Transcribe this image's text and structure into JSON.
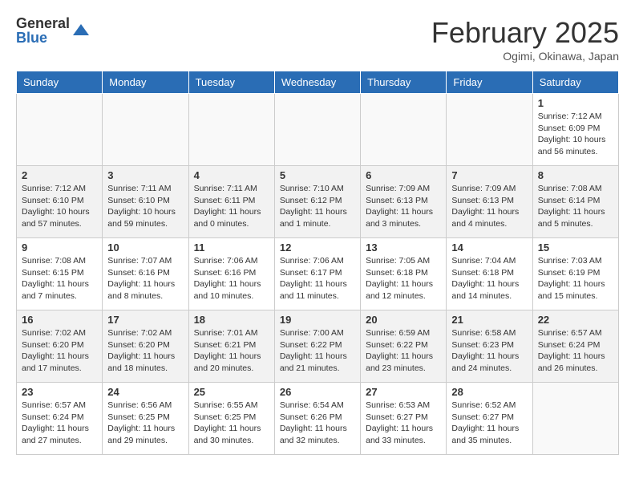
{
  "logo": {
    "general": "General",
    "blue": "Blue"
  },
  "header": {
    "month": "February 2025",
    "location": "Ogimi, Okinawa, Japan"
  },
  "weekdays": [
    "Sunday",
    "Monday",
    "Tuesday",
    "Wednesday",
    "Thursday",
    "Friday",
    "Saturday"
  ],
  "weeks": [
    [
      {
        "day": "",
        "info": ""
      },
      {
        "day": "",
        "info": ""
      },
      {
        "day": "",
        "info": ""
      },
      {
        "day": "",
        "info": ""
      },
      {
        "day": "",
        "info": ""
      },
      {
        "day": "",
        "info": ""
      },
      {
        "day": "1",
        "info": "Sunrise: 7:12 AM\nSunset: 6:09 PM\nDaylight: 10 hours\nand 56 minutes."
      }
    ],
    [
      {
        "day": "2",
        "info": "Sunrise: 7:12 AM\nSunset: 6:10 PM\nDaylight: 10 hours\nand 57 minutes."
      },
      {
        "day": "3",
        "info": "Sunrise: 7:11 AM\nSunset: 6:10 PM\nDaylight: 10 hours\nand 59 minutes."
      },
      {
        "day": "4",
        "info": "Sunrise: 7:11 AM\nSunset: 6:11 PM\nDaylight: 11 hours\nand 0 minutes."
      },
      {
        "day": "5",
        "info": "Sunrise: 7:10 AM\nSunset: 6:12 PM\nDaylight: 11 hours\nand 1 minute."
      },
      {
        "day": "6",
        "info": "Sunrise: 7:09 AM\nSunset: 6:13 PM\nDaylight: 11 hours\nand 3 minutes."
      },
      {
        "day": "7",
        "info": "Sunrise: 7:09 AM\nSunset: 6:13 PM\nDaylight: 11 hours\nand 4 minutes."
      },
      {
        "day": "8",
        "info": "Sunrise: 7:08 AM\nSunset: 6:14 PM\nDaylight: 11 hours\nand 5 minutes."
      }
    ],
    [
      {
        "day": "9",
        "info": "Sunrise: 7:08 AM\nSunset: 6:15 PM\nDaylight: 11 hours\nand 7 minutes."
      },
      {
        "day": "10",
        "info": "Sunrise: 7:07 AM\nSunset: 6:16 PM\nDaylight: 11 hours\nand 8 minutes."
      },
      {
        "day": "11",
        "info": "Sunrise: 7:06 AM\nSunset: 6:16 PM\nDaylight: 11 hours\nand 10 minutes."
      },
      {
        "day": "12",
        "info": "Sunrise: 7:06 AM\nSunset: 6:17 PM\nDaylight: 11 hours\nand 11 minutes."
      },
      {
        "day": "13",
        "info": "Sunrise: 7:05 AM\nSunset: 6:18 PM\nDaylight: 11 hours\nand 12 minutes."
      },
      {
        "day": "14",
        "info": "Sunrise: 7:04 AM\nSunset: 6:18 PM\nDaylight: 11 hours\nand 14 minutes."
      },
      {
        "day": "15",
        "info": "Sunrise: 7:03 AM\nSunset: 6:19 PM\nDaylight: 11 hours\nand 15 minutes."
      }
    ],
    [
      {
        "day": "16",
        "info": "Sunrise: 7:02 AM\nSunset: 6:20 PM\nDaylight: 11 hours\nand 17 minutes."
      },
      {
        "day": "17",
        "info": "Sunrise: 7:02 AM\nSunset: 6:20 PM\nDaylight: 11 hours\nand 18 minutes."
      },
      {
        "day": "18",
        "info": "Sunrise: 7:01 AM\nSunset: 6:21 PM\nDaylight: 11 hours\nand 20 minutes."
      },
      {
        "day": "19",
        "info": "Sunrise: 7:00 AM\nSunset: 6:22 PM\nDaylight: 11 hours\nand 21 minutes."
      },
      {
        "day": "20",
        "info": "Sunrise: 6:59 AM\nSunset: 6:22 PM\nDaylight: 11 hours\nand 23 minutes."
      },
      {
        "day": "21",
        "info": "Sunrise: 6:58 AM\nSunset: 6:23 PM\nDaylight: 11 hours\nand 24 minutes."
      },
      {
        "day": "22",
        "info": "Sunrise: 6:57 AM\nSunset: 6:24 PM\nDaylight: 11 hours\nand 26 minutes."
      }
    ],
    [
      {
        "day": "23",
        "info": "Sunrise: 6:57 AM\nSunset: 6:24 PM\nDaylight: 11 hours\nand 27 minutes."
      },
      {
        "day": "24",
        "info": "Sunrise: 6:56 AM\nSunset: 6:25 PM\nDaylight: 11 hours\nand 29 minutes."
      },
      {
        "day": "25",
        "info": "Sunrise: 6:55 AM\nSunset: 6:25 PM\nDaylight: 11 hours\nand 30 minutes."
      },
      {
        "day": "26",
        "info": "Sunrise: 6:54 AM\nSunset: 6:26 PM\nDaylight: 11 hours\nand 32 minutes."
      },
      {
        "day": "27",
        "info": "Sunrise: 6:53 AM\nSunset: 6:27 PM\nDaylight: 11 hours\nand 33 minutes."
      },
      {
        "day": "28",
        "info": "Sunrise: 6:52 AM\nSunset: 6:27 PM\nDaylight: 11 hours\nand 35 minutes."
      },
      {
        "day": "",
        "info": ""
      }
    ]
  ]
}
